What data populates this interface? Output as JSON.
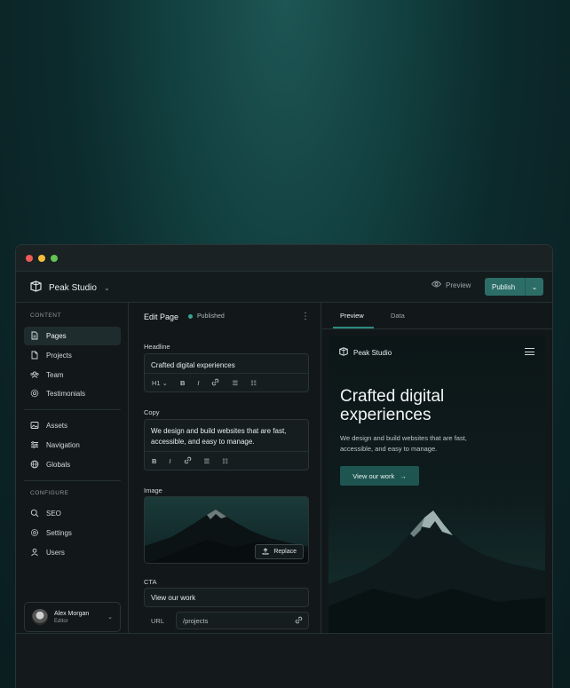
{
  "app": {
    "brand": "Peak Studio",
    "preview_label": "Preview",
    "publish_label": "Publish"
  },
  "sidebar": {
    "content_label": "CONTENT",
    "configure_label": "CONFIGURE",
    "items": [
      {
        "label": "Pages",
        "icon": "page-icon"
      },
      {
        "label": "Projects",
        "icon": "file-icon"
      },
      {
        "label": "Team",
        "icon": "users-icon"
      },
      {
        "label": "Testimonials",
        "icon": "badge-icon"
      },
      {
        "label": "Assets",
        "icon": "image-icon"
      },
      {
        "label": "Navigation",
        "icon": "navigation-icon"
      },
      {
        "label": "Globals",
        "icon": "globe-icon"
      },
      {
        "label": "SEO",
        "icon": "search-icon"
      },
      {
        "label": "Settings",
        "icon": "gear-icon"
      },
      {
        "label": "Users",
        "icon": "user-icon"
      }
    ],
    "user": {
      "name": "Alex Morgan",
      "role": "Editor"
    }
  },
  "editor": {
    "title": "Edit Page",
    "status": "Published",
    "headline_label": "Headline",
    "headline_value": "Crafted digital experiences",
    "heading_level": "H1",
    "copy_label": "Copy",
    "copy_value": "We design and build websites that are fast, accessible, and easy to manage.",
    "image_label": "Image",
    "replace_label": "Replace",
    "cta_label": "CTA",
    "cta_value": "View our work",
    "url_label": "URL",
    "url_value": "/projects"
  },
  "preview": {
    "tabs": [
      "Preview",
      "Data"
    ],
    "brand": "Peak Studio",
    "hero_title": "Crafted digital experiences",
    "hero_copy": "We design and build websites that are fast, accessible, and easy to manage.",
    "cta": "View our work"
  },
  "colors": {
    "accent": "#2c6e67",
    "status_dot": "#3aa394",
    "background": "#12181a"
  }
}
